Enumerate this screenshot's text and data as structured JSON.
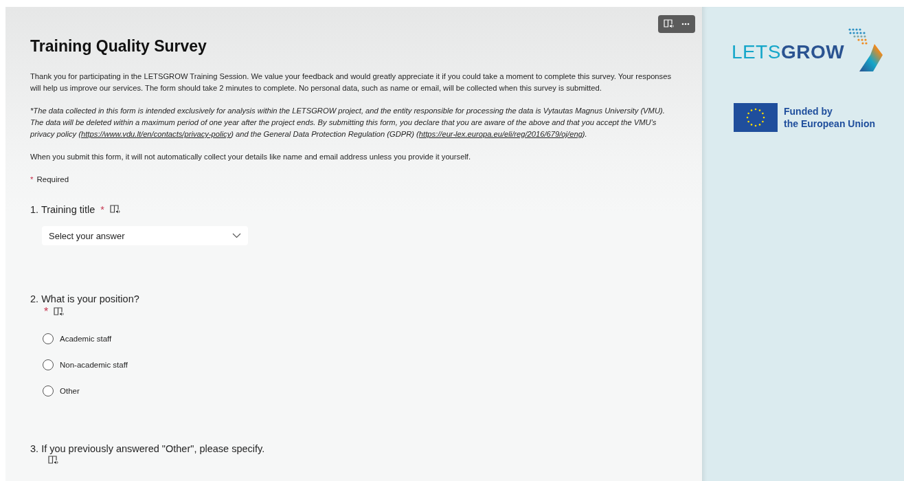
{
  "title": "Training Quality Survey",
  "intro": "Thank you for participating in the LETSGROW Training Session. We value your feedback and would greatly appreciate it if you could take a moment to complete this survey. Your responses will help us improve our services. The form should take 2 minutes to complete. No personal data, such as name or email, will be collected when this survey is submitted.",
  "privacy_notice": [
    {
      "kind": "text",
      "text": "*The data collected in this form is intended exclusively for analysis within the LETSGROW project, and the entity responsible for processing the data is Vytautas Magnus University (VMU). The data will be deleted within a maximum period of one year after the project ends. By submitting this form, you declare that you are aware of the above and that you accept the VMU’s privacy policy ("
    },
    {
      "kind": "link",
      "text": "https://www.vdu.lt/en/contacts/privacy-policy"
    },
    {
      "kind": "text",
      "text": ") and the General Data Protection Regulation (GDPR) ("
    },
    {
      "kind": "link",
      "text": "https://eur-lex.europa.eu/eli/reg/2016/679/oj/eng"
    },
    {
      "kind": "text",
      "text": ")."
    }
  ],
  "collection_note": "When you submit this form, it will not automatically collect your details like name and email address unless you provide it yourself.",
  "required_legend": {
    "mark": "*",
    "label": "Required"
  },
  "questions": [
    {
      "number": "1.",
      "title": "Training title",
      "required": true,
      "kind": "dropdown",
      "placeholder": "Select your answer"
    },
    {
      "number": "2.",
      "title": "What is your position?",
      "required": true,
      "kind": "choice",
      "options": [
        {
          "label": "Academic staff",
          "selected": false
        },
        {
          "label": "Non-academic staff",
          "selected": false
        },
        {
          "label": "Other",
          "selected": false
        }
      ]
    },
    {
      "number": "3.",
      "title": "If you previously answered \"Other\", please specify.",
      "required": false,
      "kind": "text"
    }
  ],
  "logo": {
    "light": "LETS",
    "bold": "GROW"
  },
  "funding_lines": [
    "Funded by",
    "the European Union"
  ]
}
